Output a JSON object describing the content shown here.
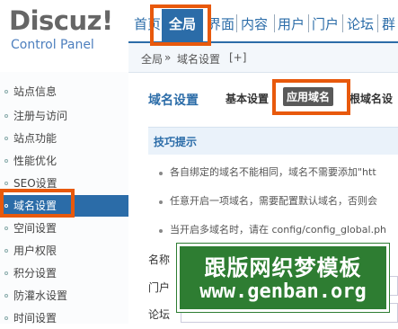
{
  "logo": {
    "brand": "Discuz!",
    "sub": "Control Panel"
  },
  "topnav": {
    "items": [
      {
        "label": "首页"
      },
      {
        "label": "全局"
      },
      {
        "label": "界面"
      },
      {
        "label": "内容"
      },
      {
        "label": "用户"
      },
      {
        "label": "门户"
      },
      {
        "label": "论坛"
      },
      {
        "label": "群"
      }
    ],
    "active_index": 1
  },
  "breadcrumb": {
    "root": "全局",
    "sep": "»",
    "current": "域名设置",
    "add": "[+]"
  },
  "sidebar": {
    "items": [
      {
        "label": "站点信息"
      },
      {
        "label": "注册与访问"
      },
      {
        "label": "站点功能"
      },
      {
        "label": "性能优化"
      },
      {
        "label": "SEO设置"
      },
      {
        "label": "域名设置"
      },
      {
        "label": "空间设置"
      },
      {
        "label": "用户权限"
      },
      {
        "label": "积分设置"
      },
      {
        "label": "防灌水设置"
      },
      {
        "label": "时间设置"
      }
    ],
    "active_index": 5
  },
  "main": {
    "title": "域名设置",
    "subtabs": [
      {
        "label": "基本设置"
      },
      {
        "label": "应用域名"
      },
      {
        "label": "根域名设"
      }
    ],
    "current_subtab_index": 1,
    "tips_title": "技巧提示",
    "tips": [
      {
        "text": "各自绑定的域名不能相同，域名不需要添加\"htt"
      },
      {
        "text": "任意开启一项域名，需要配置默认域名，否则会"
      },
      {
        "text": "当开启多域名时，请在 config/config_global.ph"
      }
    ],
    "table_labels": [
      {
        "label": "名称"
      },
      {
        "label": "门户"
      },
      {
        "label": "论坛"
      }
    ]
  },
  "watermark": {
    "line1": "跟版网织梦模板",
    "line2": "www.genban.org"
  },
  "colors": {
    "accent": "#2b6ca8",
    "highlight": "#e8590c",
    "watermark": "#2e7d32"
  }
}
